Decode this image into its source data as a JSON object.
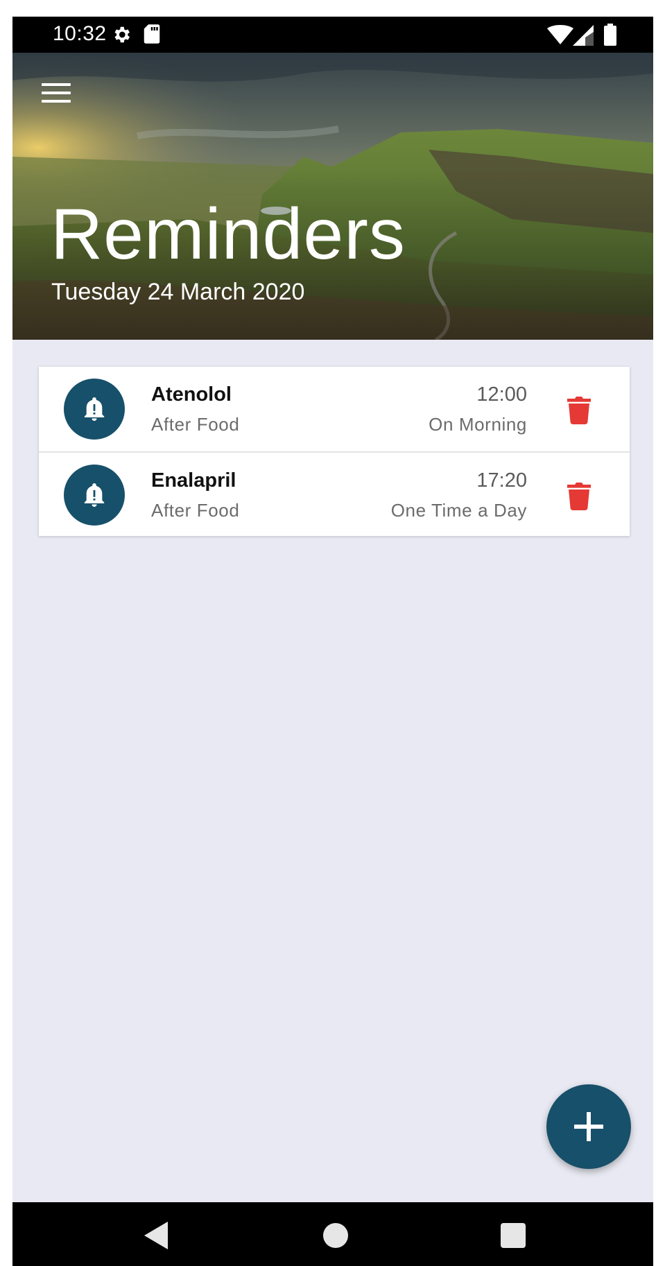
{
  "status_bar": {
    "time": "10:32",
    "icons": [
      "gear-icon",
      "sd-card-icon",
      "wifi-icon",
      "cellular-signal-icon",
      "battery-icon"
    ]
  },
  "header": {
    "title": "Reminders",
    "date": "Tuesday 24 March 2020",
    "menu_icon": "hamburger-menu-icon"
  },
  "reminders": [
    {
      "name": "Atenolol",
      "note": "After Food",
      "time": "12:00",
      "frequency": "On Morning",
      "icon": "bell-alert-icon",
      "delete_icon": "trash-icon"
    },
    {
      "name": "Enalapril",
      "note": "After Food",
      "time": "17:20",
      "frequency": "One Time a Day",
      "icon": "bell-alert-icon",
      "delete_icon": "trash-icon"
    }
  ],
  "fab": {
    "icon": "plus-icon"
  },
  "nav_bar": {
    "icons": [
      "back-icon",
      "home-icon",
      "recents-icon"
    ]
  },
  "colors": {
    "accent": "#17506a",
    "delete": "#e53935",
    "background": "#e8e9f2"
  }
}
